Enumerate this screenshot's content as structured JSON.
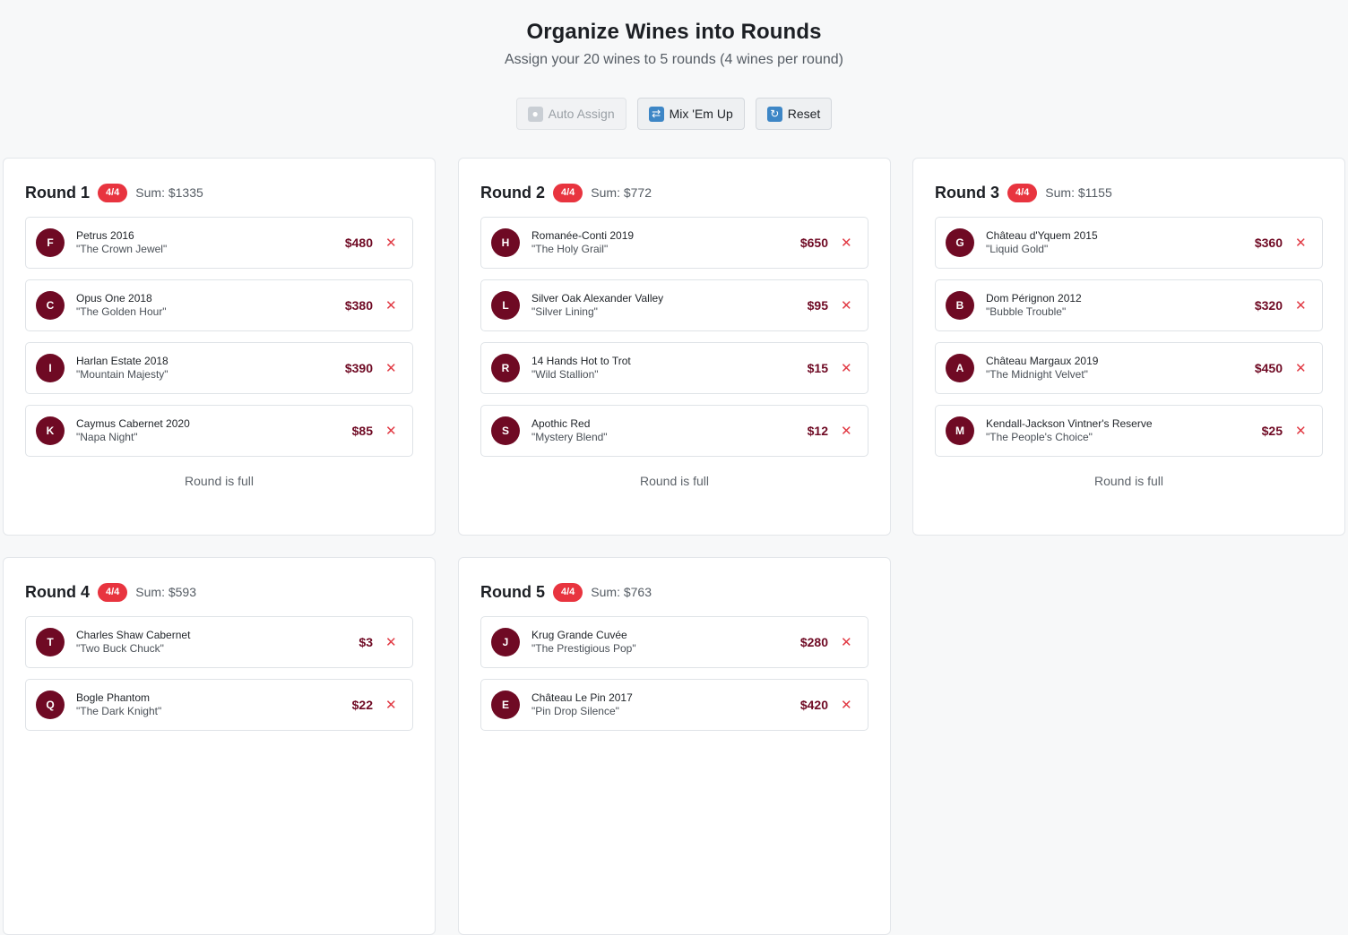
{
  "header": {
    "title": "Organize Wines into Rounds",
    "subtitle": "Assign your 20 wines to 5 rounds (4 wines per round)"
  },
  "toolbar": {
    "auto_assign": {
      "label": "Auto Assign",
      "icon": "robot-icon",
      "disabled": true
    },
    "mix": {
      "label": "Mix 'Em Up",
      "icon": "shuffle-icon"
    },
    "reset": {
      "label": "Reset",
      "icon": "refresh-icon"
    }
  },
  "rounds": [
    {
      "title": "Round 1",
      "badge": "4/4",
      "sum": "Sum: $1335",
      "status": "Round is full",
      "wines": [
        {
          "letter": "F",
          "name": "Petrus 2016",
          "nickname": "\"The Crown Jewel\"",
          "price": "$480"
        },
        {
          "letter": "C",
          "name": "Opus One 2018",
          "nickname": "\"The Golden Hour\"",
          "price": "$380"
        },
        {
          "letter": "I",
          "name": "Harlan Estate 2018",
          "nickname": "\"Mountain Majesty\"",
          "price": "$390"
        },
        {
          "letter": "K",
          "name": "Caymus Cabernet 2020",
          "nickname": "\"Napa Night\"",
          "price": "$85"
        }
      ]
    },
    {
      "title": "Round 2",
      "badge": "4/4",
      "sum": "Sum: $772",
      "status": "Round is full",
      "wines": [
        {
          "letter": "H",
          "name": "Romanée-Conti 2019",
          "nickname": "\"The Holy Grail\"",
          "price": "$650"
        },
        {
          "letter": "L",
          "name": "Silver Oak Alexander Valley",
          "nickname": "\"Silver Lining\"",
          "price": "$95"
        },
        {
          "letter": "R",
          "name": "14 Hands Hot to Trot",
          "nickname": "\"Wild Stallion\"",
          "price": "$15"
        },
        {
          "letter": "S",
          "name": "Apothic Red",
          "nickname": "\"Mystery Blend\"",
          "price": "$12"
        }
      ]
    },
    {
      "title": "Round 3",
      "badge": "4/4",
      "sum": "Sum: $1155",
      "status": "Round is full",
      "wines": [
        {
          "letter": "G",
          "name": "Château d'Yquem 2015",
          "nickname": "\"Liquid Gold\"",
          "price": "$360"
        },
        {
          "letter": "B",
          "name": "Dom Pérignon 2012",
          "nickname": "\"Bubble Trouble\"",
          "price": "$320"
        },
        {
          "letter": "A",
          "name": "Château Margaux 2019",
          "nickname": "\"The Midnight Velvet\"",
          "price": "$450"
        },
        {
          "letter": "M",
          "name": "Kendall-Jackson Vintner's Reserve",
          "nickname": "\"The People's Choice\"",
          "price": "$25"
        }
      ]
    },
    {
      "title": "Round 4",
      "badge": "4/4",
      "sum": "Sum: $593",
      "status": "",
      "wines": [
        {
          "letter": "T",
          "name": "Charles Shaw Cabernet",
          "nickname": "\"Two Buck Chuck\"",
          "price": "$3"
        },
        {
          "letter": "Q",
          "name": "Bogle Phantom",
          "nickname": "\"The Dark Knight\"",
          "price": "$22"
        }
      ]
    },
    {
      "title": "Round 5",
      "badge": "4/4",
      "sum": "Sum: $763",
      "status": "",
      "wines": [
        {
          "letter": "J",
          "name": "Krug Grande Cuvée",
          "nickname": "\"The Prestigious Pop\"",
          "price": "$280"
        },
        {
          "letter": "E",
          "name": "Château Le Pin 2017",
          "nickname": "\"Pin Drop Silence\"",
          "price": "$420"
        }
      ]
    }
  ],
  "colors": {
    "accent_wine": "#6f0a24",
    "badge_red": "#e8343f",
    "remove_red": "#e13a44"
  }
}
